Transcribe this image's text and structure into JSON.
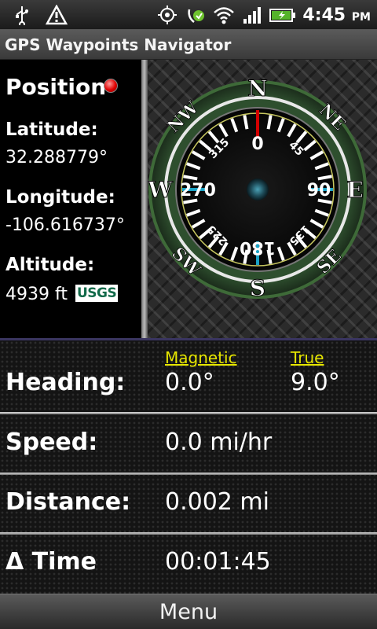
{
  "status_bar": {
    "time": "4:45",
    "ampm": "PM",
    "icons": [
      "usb-icon",
      "warning-icon",
      "gps-icon",
      "sync-icon",
      "wifi-icon",
      "signal-icon",
      "battery-icon"
    ]
  },
  "app": {
    "title": "GPS Waypoints Navigator"
  },
  "position": {
    "title": "Position",
    "latitude_label": "Latitude:",
    "latitude_value": "32.288779°",
    "longitude_label": "Longitude:",
    "longitude_value": "-106.616737°",
    "altitude_label": "Altitude:",
    "altitude_value": "4939 ft",
    "source_badge": "USGS"
  },
  "compass": {
    "cardinals": {
      "n": "N",
      "e": "E",
      "s": "S",
      "w": "W"
    },
    "ordinals": {
      "ne": "NE",
      "se": "SE",
      "sw": "SW",
      "nw": "NW"
    },
    "degrees": {
      "d0": "0",
      "d45": "45",
      "d90": "90",
      "d135": "135",
      "d180": "180",
      "d225": "225",
      "d270": "270",
      "d315": "315"
    },
    "heading_degrees": 0
  },
  "heading": {
    "label": "Heading:",
    "magnetic_label": "Magnetic",
    "true_label": "True",
    "magnetic_value": "0.0°",
    "true_value": "9.0°"
  },
  "speed": {
    "label": "Speed:",
    "value": "0.0 mi/hr"
  },
  "distance": {
    "label": "Distance:",
    "value": "0.002 mi"
  },
  "time": {
    "label": "Δ Time",
    "value": "00:01:45"
  },
  "menu": {
    "label": "Menu"
  },
  "colors": {
    "accent_yellow": "#e6e600",
    "needle_red": "#d40000",
    "tick_cyan": "#1aa3c6"
  }
}
